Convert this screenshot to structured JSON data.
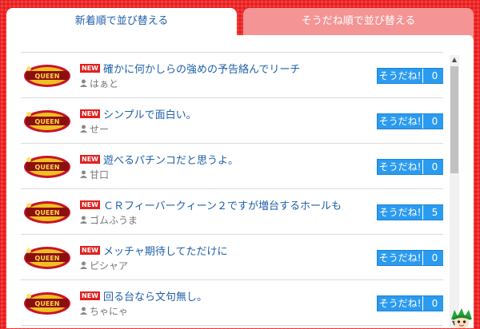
{
  "tabs": {
    "newest": "新着順で並び替える",
    "like_order": "そうだね順で並び替える"
  },
  "posts": [
    {
      "badge": "NEW",
      "title": "確かに何かしらの強めの予告絡んでリーチ",
      "author": "はぁと",
      "like_label": "そうだね!",
      "like_count": "0"
    },
    {
      "badge": "NEW",
      "title": "シンプルで面白い。",
      "author": "せー",
      "like_label": "そうだね!",
      "like_count": "0"
    },
    {
      "badge": "NEW",
      "title": "遊べるパチンコだと思うよ。",
      "author": "甘口",
      "like_label": "そうだね!",
      "like_count": "0"
    },
    {
      "badge": "NEW",
      "title": "ＣＲフィーバークィーン２ですが増台するホールも",
      "author": "ゴムふうま",
      "like_label": "そうだね!",
      "like_count": "5"
    },
    {
      "badge": "NEW",
      "title": "メッチャ期待してただけに",
      "author": "ピシャア",
      "like_label": "そうだね!",
      "like_count": "0"
    },
    {
      "badge": "NEW",
      "title": "回る台なら文句無し。",
      "author": "ちゃにゃ",
      "like_label": "そうだね!",
      "like_count": "0"
    }
  ],
  "colors": {
    "background": "#ee2a2a",
    "active_tab_text": "#1f5fa8",
    "inactive_tab_bg": "#f49494",
    "like_button": "#2b9bef",
    "new_badge": "#e02020"
  },
  "icons": {
    "thumbnail": "queen-logo-icon",
    "author": "user-icon",
    "mascot": "mascot-icon"
  }
}
